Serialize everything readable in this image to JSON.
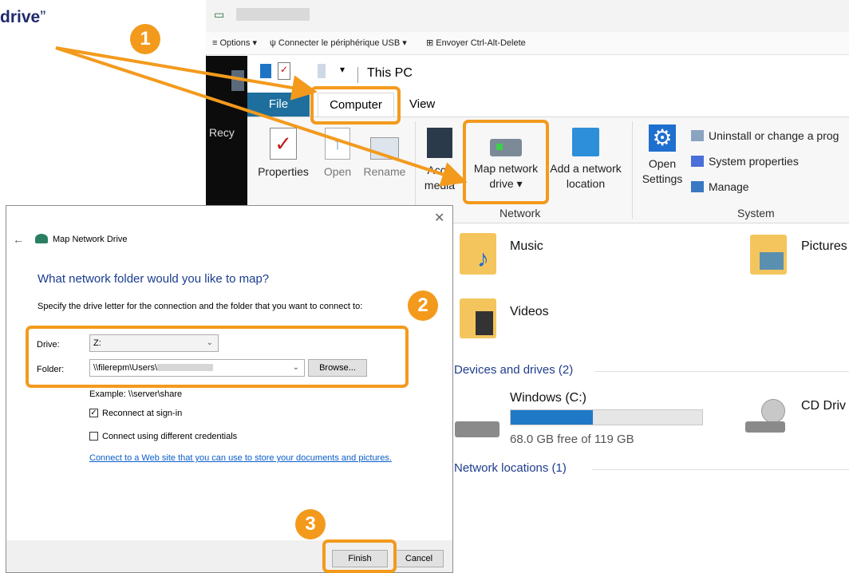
{
  "caption": {
    "text": "drive",
    "quote": "”"
  },
  "window": {
    "remote_toolbar": {
      "options": "Options ▾",
      "usb": "Connecter le périphérique USB ▾",
      "ctrl_alt_del": "Envoyer Ctrl-Alt-Delete"
    },
    "title": "This PC",
    "desktop_label": "Recy"
  },
  "tabs": {
    "file": "File",
    "computer": "Computer",
    "view": "View"
  },
  "ribbon": {
    "location": {
      "properties": "Properties",
      "open": "Open",
      "rename": "Rename"
    },
    "network": {
      "access_media_line1": "Acce",
      "access_media_line2": "media",
      "map_drive_line1": "Map network",
      "map_drive_line2": "drive ▾",
      "add_location_line1": "Add a network",
      "add_location_line2": "location",
      "group": "Network"
    },
    "system": {
      "open_settings_line1": "Open",
      "open_settings_line2": "Settings",
      "uninstall": "Uninstall or change a prog",
      "system_properties": "System properties",
      "manage": "Manage",
      "group": "System"
    }
  },
  "content": {
    "folders": {
      "music": "Music",
      "pictures": "Pictures",
      "videos": "Videos"
    },
    "devices_header": "Devices and drives (2)",
    "drive_c": {
      "name": "Windows (C:)",
      "free": "68.0 GB free of 119 GB",
      "used_fraction": 0.43
    },
    "cd_drive": "CD Driv",
    "network_header": "Network locations (1)"
  },
  "dialog": {
    "close": "✕",
    "back": "←",
    "title": "Map Network Drive",
    "heading": "What network folder would you like to map?",
    "instruction": "Specify the drive letter for the connection and the folder that you want to connect to:",
    "drive_label": "Drive:",
    "drive_value": "Z:",
    "folder_label": "Folder:",
    "folder_value": "\\\\filerepm\\Users\\",
    "browse": "Browse...",
    "example": "Example: \\\\server\\share",
    "reconnect": "Reconnect at sign-in",
    "reconnect_checked": true,
    "different_credentials": "Connect using different credentials",
    "link": "Connect to a Web site that you can use to store your documents and pictures.",
    "finish": "Finish",
    "cancel": "Cancel"
  },
  "badges": [
    "1",
    "2",
    "3"
  ],
  "colors": {
    "highlight": "#f39a1d",
    "file_tab": "#1e6f9d",
    "link": "#0b5ec9",
    "heading": "#1a3c8f",
    "drive_bar": "#1f79c7"
  }
}
